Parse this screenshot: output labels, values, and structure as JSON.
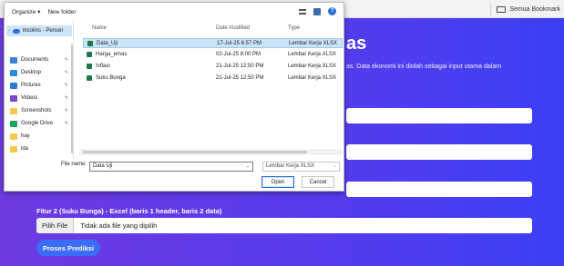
{
  "browser": {
    "bookmarks_label": "Semua Bookmark"
  },
  "page": {
    "title_fragment": "as",
    "description_fragment": "as. Data ekonomi ini diolah sebagai input utama dalam",
    "fitur2_label": "Fitur 2 (Suku Bunga) - Excel (baris 1 header, baris 2 data)",
    "choose_file_label": "Pilih File",
    "no_file_text": "Tidak ada file yang dipilih",
    "submit_label": "Proses Prediksi",
    "colors": {
      "gradient_start": "#6d3ae0",
      "gradient_end": "#3b3ff5",
      "button": "#3b6cf6"
    }
  },
  "dialog": {
    "toolbar": {
      "organize_label": "Organize ▾",
      "new_folder_label": "New folder"
    },
    "nav": {
      "home_label": "mcolins - Person",
      "items": [
        {
          "label": "Documents",
          "icon": "documents-icon",
          "color": "#3d7fd6"
        },
        {
          "label": "Desktop",
          "icon": "desktop-icon",
          "color": "#2f8bd9"
        },
        {
          "label": "Pictures",
          "icon": "pictures-icon",
          "color": "#2f7ad1"
        },
        {
          "label": "Videos",
          "icon": "videos-icon",
          "color": "#7c48c9"
        },
        {
          "label": "Screenshots",
          "icon": "folder-icon",
          "color": "#f2c94c"
        },
        {
          "label": "Google Drive",
          "icon": "google-drive-icon",
          "color": "#1ea362"
        },
        {
          "label": "hay",
          "icon": "folder-icon",
          "color": "#f2c94c"
        },
        {
          "label": "ida",
          "icon": "folder-icon",
          "color": "#f2c94c"
        }
      ]
    },
    "columns": {
      "name": "Name",
      "date_modified": "Date modified",
      "type": "Type"
    },
    "files": [
      {
        "name": "Data_Uji",
        "date": "17-Jul-25 6:57 PM",
        "type": "Lembar Kerja XLSX",
        "selected": true
      },
      {
        "name": "Harga_emas",
        "date": "02-Jul-25 8:00 PM",
        "type": "Lembar Kerja XLSX",
        "selected": false
      },
      {
        "name": "Inflasi",
        "date": "21-Jul-25 12:50 PM",
        "type": "Lembar Kerja XLSX",
        "selected": false
      },
      {
        "name": "Suku Bunga",
        "date": "21-Jul-25 12:50 PM",
        "type": "Lembar Kerja XLSX",
        "selected": false
      }
    ],
    "footer": {
      "filename_label": "File name:",
      "filename_value": "Data Uji",
      "filetype_value": "Lembar Kerja XLSX",
      "open_label": "Open",
      "cancel_label": "Cancel"
    }
  }
}
